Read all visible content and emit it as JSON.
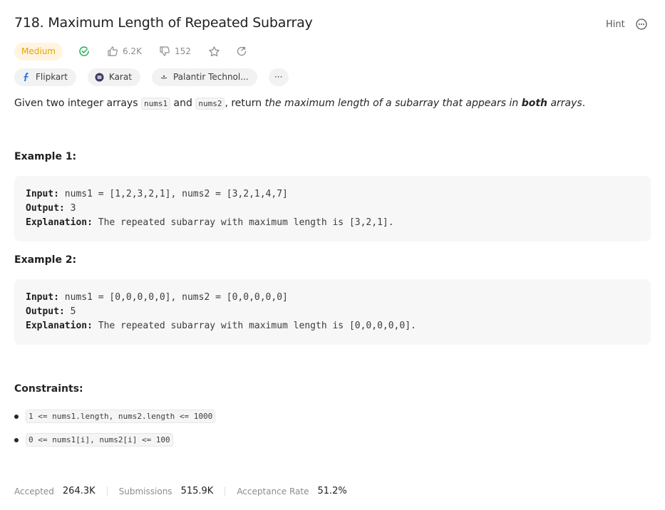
{
  "problem": {
    "title": "718. Maximum Length of Repeated Subarray",
    "hint_label": "Hint",
    "difficulty": "Medium",
    "likes": "6.2K",
    "dislikes": "152"
  },
  "companies": [
    {
      "name": "Flipkart"
    },
    {
      "name": "Karat"
    },
    {
      "name": "Palantir Technol..."
    }
  ],
  "more_label": "···",
  "description": {
    "p1": "Given two integer arrays ",
    "code1": "nums1",
    "p2": " and ",
    "code2": "nums2",
    "p3": ", return ",
    "em1": "the maximum length of a subarray that appears in ",
    "strong": "both",
    "em2": " arrays",
    "p4": "."
  },
  "examples": [
    {
      "heading": "Example 1:",
      "input_label": "Input:",
      "input": " nums1 = [1,2,3,2,1], nums2 = [3,2,1,4,7]",
      "output_label": "Output:",
      "output": " 3",
      "explanation_label": "Explanation:",
      "explanation": " The repeated subarray with maximum length is [3,2,1]."
    },
    {
      "heading": "Example 2:",
      "input_label": "Input:",
      "input": " nums1 = [0,0,0,0,0], nums2 = [0,0,0,0,0]",
      "output_label": "Output:",
      "output": " 5",
      "explanation_label": "Explanation:",
      "explanation": " The repeated subarray with maximum length is [0,0,0,0,0]."
    }
  ],
  "constraints_heading": "Constraints:",
  "constraints": [
    "1 <= nums1.length, nums2.length <= 1000",
    "0 <= nums1[i], nums2[i] <= 100"
  ],
  "stats": {
    "accepted_label": "Accepted",
    "accepted": "264.3K",
    "submissions_label": "Submissions",
    "submissions": "515.9K",
    "rate_label": "Acceptance Rate",
    "rate": "51.2%"
  },
  "colors": {
    "medium_bg": "#fff4e0",
    "medium_text": "#e6a400",
    "solved_green": "#2db55d"
  }
}
